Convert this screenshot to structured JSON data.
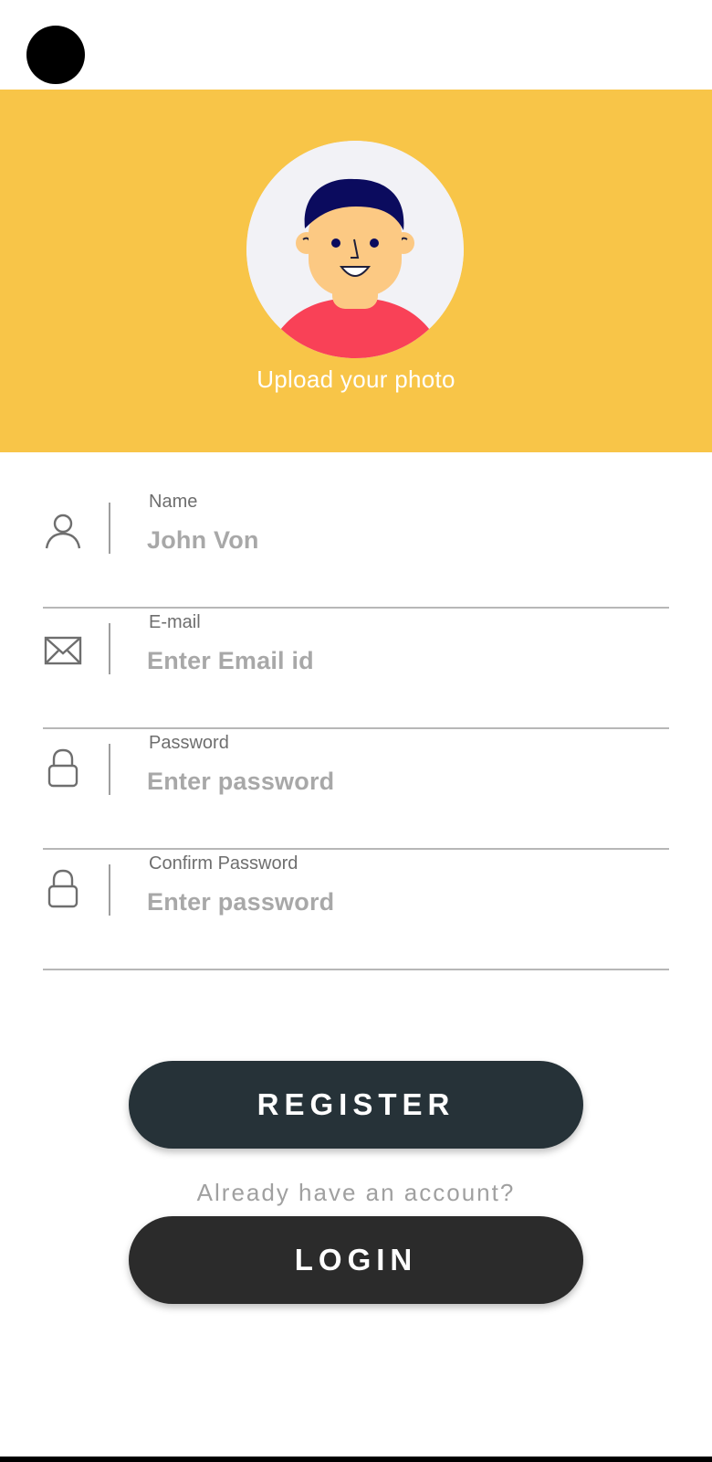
{
  "header": {
    "upload_label": "Upload your photo",
    "background_color": "#F8C548"
  },
  "form": {
    "fields": [
      {
        "label": "Name",
        "value": "John Von",
        "icon": "person-icon"
      },
      {
        "label": "E-mail",
        "value": "Enter Email id",
        "icon": "mail-icon"
      },
      {
        "label": "Password",
        "value": "Enter password",
        "icon": "lock-icon"
      },
      {
        "label": "Confirm Password",
        "value": "Enter password",
        "icon": "lock-icon"
      }
    ]
  },
  "actions": {
    "register_label": "REGISTER",
    "already_text": "Already have an account?",
    "login_label": "LOGIN",
    "register_color": "#263238",
    "login_color": "#2B2B2B"
  }
}
